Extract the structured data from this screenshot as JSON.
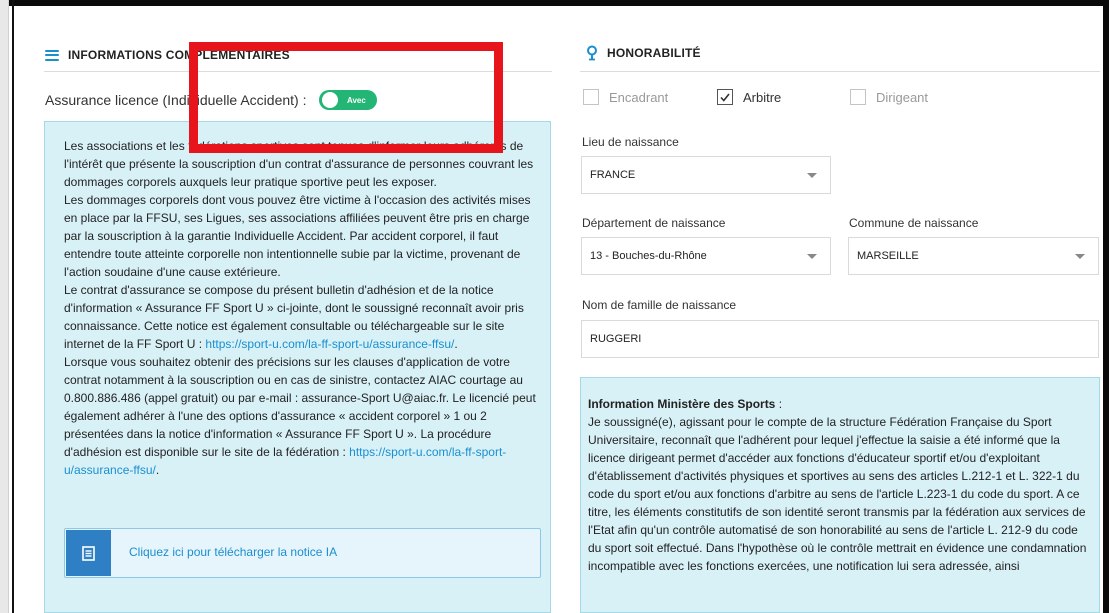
{
  "left_section": {
    "title": "INFORMATIONS COMPLÉMENTAIRES",
    "title_icon": "menu-icon",
    "assurance_label": "Assurance licence (Individuelle Accident) :",
    "toggle_label": "Avec",
    "toggle_on": true,
    "info_paragraphs": [
      "Les associations et les fédérations sportives sont tenues d'informer leurs adhérents de l'intérêt que présente la souscription d'un contrat d'assurance de personnes couvrant les dommages corporels auxquels leur pratique sportive peut les exposer.",
      "Les dommages corporels dont vous pouvez être victime à l'occasion des activités mises en place par la FFSU, ses Ligues, ses associations affiliées peuvent être pris en charge par la souscription à la garantie Individuelle Accident. Par accident corporel, il faut entendre toute atteinte corporelle non intentionnelle subie par la victime, provenant de l'action soudaine d'une cause extérieure."
    ],
    "info_p3_text": "Le contrat d'assurance se compose du présent bulletin d'adhésion et de la notice d'information « Assurance FF Sport U » ci-jointe, dont le soussigné reconnaît avoir pris connaissance. Cette notice est également consultable ou téléchargeable sur le site internet de la FF Sport U : ",
    "info_p3_link": "https://sport-u.com/la-ff-sport-u/assurance-ffsu/",
    "info_p3_end": ".",
    "info_p4_text": "Lorsque vous souhaitez obtenir des précisions sur les clauses d'application de votre contrat notamment à la souscription ou en cas de sinistre, contactez AIAC courtage au 0.800.886.486 (appel gratuit) ou par e-mail : assurance-Sport U@aiac.fr. Le licencié peut également adhérer à l'une des options d'assurance « accident corporel » 1 ou 2 présentées dans la notice d'information « Assurance FF Sport U ». La procédure d'adhésion est disponible sur le site de la fédération : ",
    "info_p4_link": "https://sport-u.com/la-ff-sport-u/assurance-ffsu/",
    "info_p4_end": ".",
    "download_label": "Cliquez ici pour télécharger la notice IA",
    "download_icon": "document-icon"
  },
  "right_section": {
    "title": "HONORABILITÉ",
    "title_icon": "pin-icon",
    "roles": [
      {
        "label": "Encadrant",
        "checked": false
      },
      {
        "label": "Arbitre",
        "checked": true
      },
      {
        "label": "Dirigeant",
        "checked": false
      }
    ],
    "lieu_label": "Lieu de naissance",
    "lieu_value": "FRANCE",
    "departement_label": "Département de naissance",
    "departement_value": "13 - Bouches-du-Rhône",
    "commune_label": "Commune de naissance",
    "commune_value": "MARSEILLE",
    "nom_label": "Nom de famille de naissance",
    "nom_value": "RUGGERI",
    "info_title": "Information Ministère des Sports",
    "info_title_suffix": " :",
    "info_text": "Je soussigné(e), agissant pour le compte de la structure Fédération Française du Sport Universitaire, reconnaît que l'adhérent pour lequel j'effectue la saisie a été informé que la licence dirigeant permet d'accéder aux fonctions d'éducateur sportif et/ou d'exploitant d'établissement d'activités physiques et sportives au sens des articles L.212-1 et L. 322-1 du code du sport et/ou aux fonctions d'arbitre au sens de l'article L.223-1 du code du sport. A ce titre, les éléments constitutifs de son identité seront transmis par la fédération aux services de l'Etat afin qu'un contrôle automatisé de son honorabilité au sens de l'article L. 212-9 du code du sport soit effectué. Dans l'hypothèse où le contrôle mettrait en évidence une condamnation incompatible avec les fonctions exercées, une notification lui sera adressée, ainsi"
  },
  "colors": {
    "accent": "#1a8fd0",
    "toggle_on": "#22b573",
    "info_bg": "#d8f1f7",
    "highlight": "#e8141c"
  }
}
